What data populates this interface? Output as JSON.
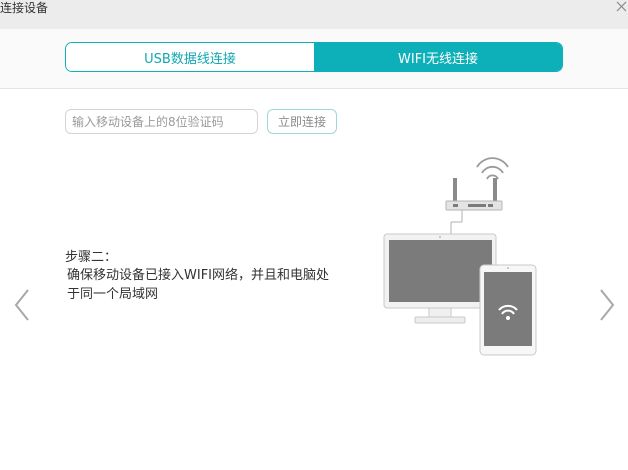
{
  "window": {
    "title": "连接设备",
    "close_icon": "close-icon"
  },
  "tabs": [
    {
      "label": "USB数据线连接",
      "active": false
    },
    {
      "label": "WIFI无线连接",
      "active": true
    }
  ],
  "verify": {
    "placeholder": "输入移动设备上的8位验证码",
    "value": "",
    "button_label": "立即连接"
  },
  "step": {
    "title": "步骤二：",
    "description": "确保移动设备已接入WIFI网络，并且和电脑处于同一个局域网"
  },
  "navigation": {
    "prev_icon": "chevron-left-icon",
    "next_icon": "chevron-right-icon"
  },
  "illustration": {
    "icons": [
      "router-icon",
      "monitor-icon",
      "tablet-icon",
      "wifi-icon"
    ]
  },
  "colors": {
    "accent": "#0db0b8",
    "titlebar_bg": "#ececec",
    "device_gray": "#7b7b7b"
  }
}
